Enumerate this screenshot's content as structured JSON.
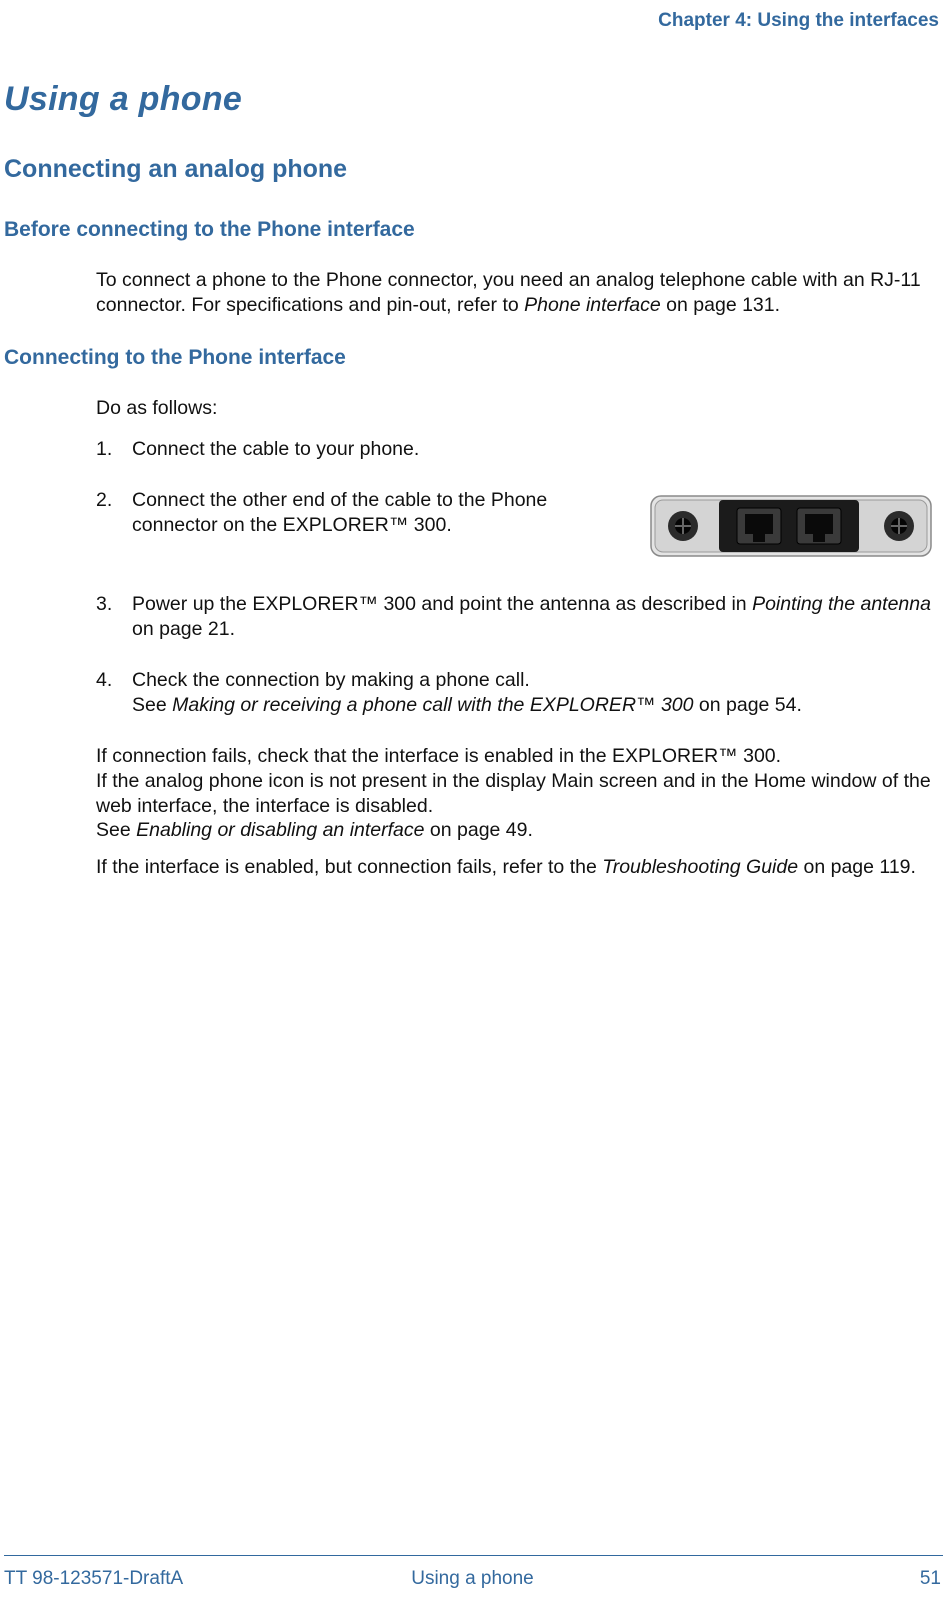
{
  "header": {
    "chapter": "Chapter 4: Using the interfaces"
  },
  "title": "Using a phone",
  "h2": "Connecting an analog phone",
  "sec1": {
    "heading": "Before connecting to the Phone interface",
    "para_a": "To connect a phone to the Phone connector, you need an analog telephone cable with an RJ-11 connector. For specifications and pin-out, refer to ",
    "para_ref": "Phone interface",
    "para_b": " on page 131."
  },
  "sec2": {
    "heading": "Connecting to the Phone interface",
    "intro": "Do as follows:",
    "steps": {
      "n1": "1.",
      "s1": "Connect the cable to your phone.",
      "n2": "2.",
      "s2": "Connect the other end of the cable to the Phone connector on the EXPLORER™ 300.",
      "n3": "3.",
      "s3a": "Power up the EXPLORER™ 300 and point the antenna as described in ",
      "s3ref": "Pointing the antenna",
      "s3b": " on page 21.",
      "n4": "4.",
      "s4a": "Check the connection by making a phone call.",
      "s4b_pre": "See ",
      "s4ref": "Making or receiving a phone call with the EXPLORER™ 300",
      "s4b_post": " on page 54."
    },
    "tail": {
      "p1": "If connection fails, check that the interface is enabled in the EXPLORER™ 300.",
      "p2": "If the analog phone icon is not present in the display Main screen and in the Home window of the web interface, the interface is disabled.",
      "p3_pre": "See ",
      "p3_ref": "Enabling or disabling an interface",
      "p3_post": " on page 49.",
      "p4_pre": "If the interface is enabled, but connection fails, refer to the ",
      "p4_ref": "Troubleshooting Guide",
      "p4_post": " on page 119."
    }
  },
  "footer": {
    "left": "TT 98-123571-DraftA",
    "center": "Using a phone",
    "right": "51"
  }
}
